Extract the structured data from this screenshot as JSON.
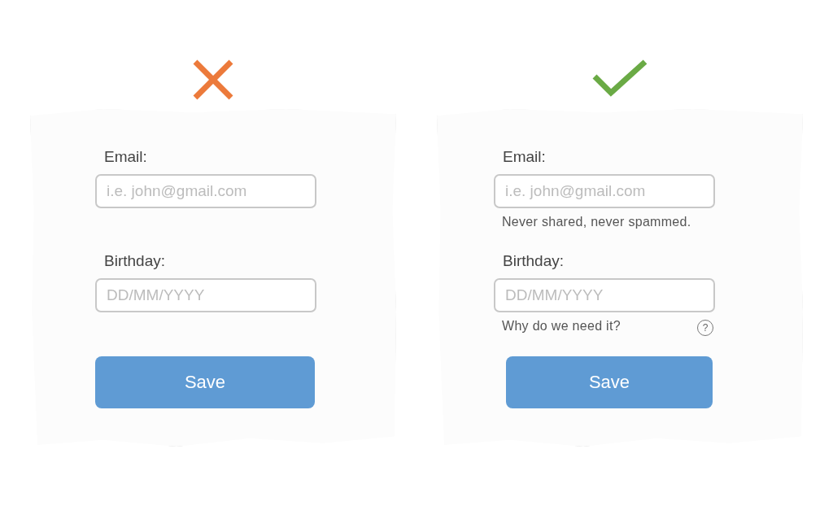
{
  "panels": [
    {
      "kind": "bad",
      "fields": [
        {
          "label": "Email:",
          "placeholder": "i.e. john@gmail.com"
        },
        {
          "label": "Birthday:",
          "placeholder": "DD/MM/YYYY"
        }
      ],
      "button": "Save"
    },
    {
      "kind": "good",
      "fields": [
        {
          "label": "Email:",
          "placeholder": "i.e. john@gmail.com",
          "hint": "Never shared, never spammed."
        },
        {
          "label": "Birthday:",
          "placeholder": "DD/MM/YYYY",
          "hint": "Why do we need it?",
          "help_icon": "?"
        }
      ],
      "button": "Save"
    }
  ]
}
